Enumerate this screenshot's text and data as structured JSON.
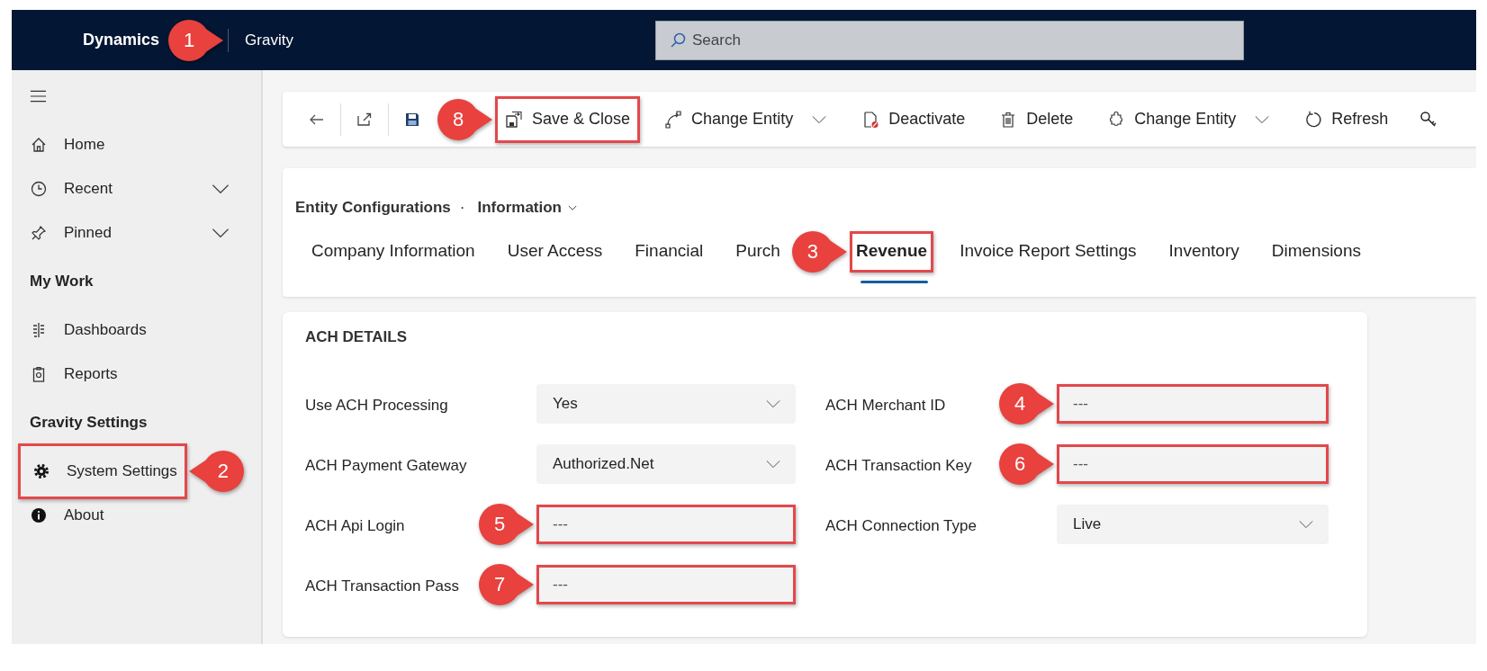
{
  "top_bar": {
    "app_name": "Dynamics",
    "app_callout": {
      "number": "1",
      "pointer_left": false
    },
    "area": "Gravity",
    "search": {
      "placeholder": "Search"
    }
  },
  "sidebar": {
    "sections": [
      {
        "items": [
          {
            "label": "Home",
            "expandable": false,
            "highlighted": false
          },
          {
            "label": "Recent",
            "expandable": true,
            "highlighted": false
          },
          {
            "label": "Pinned",
            "expandable": true,
            "highlighted": false
          }
        ]
      },
      {
        "title": "My Work",
        "items": [
          {
            "label": "Dashboards",
            "expandable": false,
            "highlighted": false
          },
          {
            "label": "Reports",
            "expandable": false,
            "highlighted": false
          }
        ]
      },
      {
        "title": "Gravity Settings",
        "items": [
          {
            "label": "System Settings",
            "expandable": false,
            "highlighted": true,
            "callout": {
              "number": "2",
              "pointer_left": true
            }
          },
          {
            "label": "About",
            "expandable": false,
            "highlighted": false
          }
        ]
      }
    ]
  },
  "toolbar": {
    "buttons": [
      {
        "label": "Save & Close",
        "dropdown": false,
        "highlighted": true,
        "callout": {
          "number": "8",
          "pointer_left": false
        }
      },
      {
        "label": "Change Entity",
        "dropdown": true,
        "highlighted": false
      },
      {
        "label": "Deactivate",
        "dropdown": false,
        "highlighted": false
      },
      {
        "label": "Delete",
        "dropdown": false,
        "highlighted": false
      },
      {
        "label": "Change Entity",
        "dropdown": true,
        "highlighted": false
      },
      {
        "label": "Refresh",
        "dropdown": false,
        "highlighted": false
      }
    ]
  },
  "header": {
    "breadcrumb": {
      "entity": "Entity Configurations",
      "separator": "·",
      "form": "Information"
    },
    "tabs": [
      {
        "label": "Company Information",
        "selected": false,
        "highlighted": false
      },
      {
        "label": "User Access",
        "selected": false,
        "highlighted": false
      },
      {
        "label": "Financial",
        "selected": false,
        "highlighted": false
      },
      {
        "label": "Purch",
        "selected": false,
        "highlighted": false
      },
      {
        "label": "Revenue",
        "selected": true,
        "highlighted": true,
        "callout": {
          "number": "3",
          "pointer_left": false
        }
      },
      {
        "label": "Invoice Report Settings",
        "selected": false,
        "highlighted": false
      },
      {
        "label": "Inventory",
        "selected": false,
        "highlighted": false
      },
      {
        "label": "Dimensions",
        "selected": false,
        "highlighted": false
      }
    ]
  },
  "section": {
    "title": "ACH DETAILS",
    "left_fields": [
      {
        "label": "Use ACH Processing",
        "kind": "select",
        "value": "Yes",
        "highlighted": false
      },
      {
        "label": "ACH Payment Gateway",
        "kind": "select",
        "value": "Authorized.Net",
        "highlighted": false
      },
      {
        "label": "ACH Api Login",
        "kind": "text",
        "value": "---",
        "highlighted": true,
        "callout": {
          "number": "5",
          "pointer_left": false
        }
      },
      {
        "label": "ACH Transaction Pass",
        "kind": "text",
        "value": "---",
        "highlighted": true,
        "callout": {
          "number": "7",
          "pointer_left": false
        }
      }
    ],
    "right_fields": [
      {
        "label": "ACH Merchant ID",
        "kind": "text",
        "value": "---",
        "highlighted": true,
        "callout": {
          "number": "4",
          "pointer_left": false
        }
      },
      {
        "label": "ACH Transaction Key",
        "kind": "text",
        "value": "---",
        "highlighted": true,
        "callout": {
          "number": "6",
          "pointer_left": false
        }
      },
      {
        "label": "ACH Connection Type",
        "kind": "select",
        "value": "Live",
        "highlighted": false
      }
    ]
  }
}
